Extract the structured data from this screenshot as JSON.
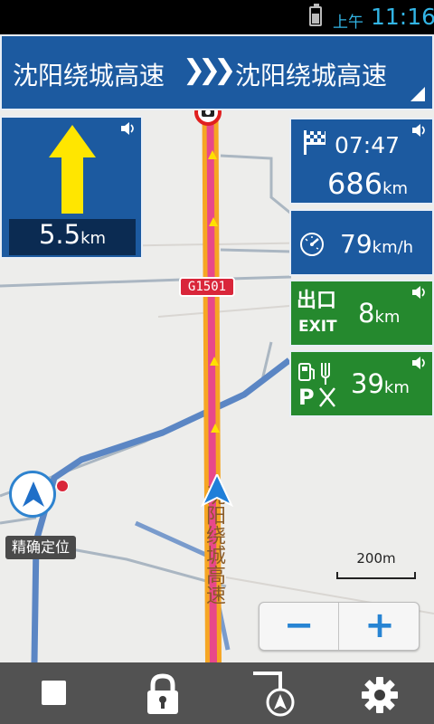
{
  "status_bar": {
    "ampm": "上午",
    "time": "11:16"
  },
  "road_banner": {
    "from_road": "沈阳绕城高速",
    "arrows": "❯❯❯",
    "to_road": "沈阳绕城高速"
  },
  "turn_panel": {
    "direction_icon": "straight-arrow-icon",
    "distance_value": "5.5",
    "distance_unit": "km"
  },
  "eta_panel": {
    "arrival_time": "07:47",
    "remaining_value": "686",
    "remaining_unit": "km"
  },
  "speed_panel": {
    "value": "79",
    "unit": "km/h"
  },
  "exit_panel": {
    "chinese_label": "出口",
    "english_label": "EXIT",
    "value": "8",
    "unit": "km"
  },
  "service_panel": {
    "value": "39",
    "unit": "km"
  },
  "map": {
    "highway_shield": "G1501",
    "road_name": "沈阳绕城高速",
    "locate_label": "精确定位",
    "scale_label": "200m"
  },
  "zoom": {
    "minus_label": "−",
    "plus_label": "+"
  },
  "bottom_bar": {
    "icons": [
      "stop-icon",
      "lock-icon",
      "route-icon",
      "settings-icon"
    ]
  },
  "colors": {
    "panel_blue": "#1c5aa0",
    "panel_green": "#25892e",
    "route_orange": "#f6a623",
    "route_pink": "#e8488a",
    "accent_blue": "#2784d3"
  }
}
